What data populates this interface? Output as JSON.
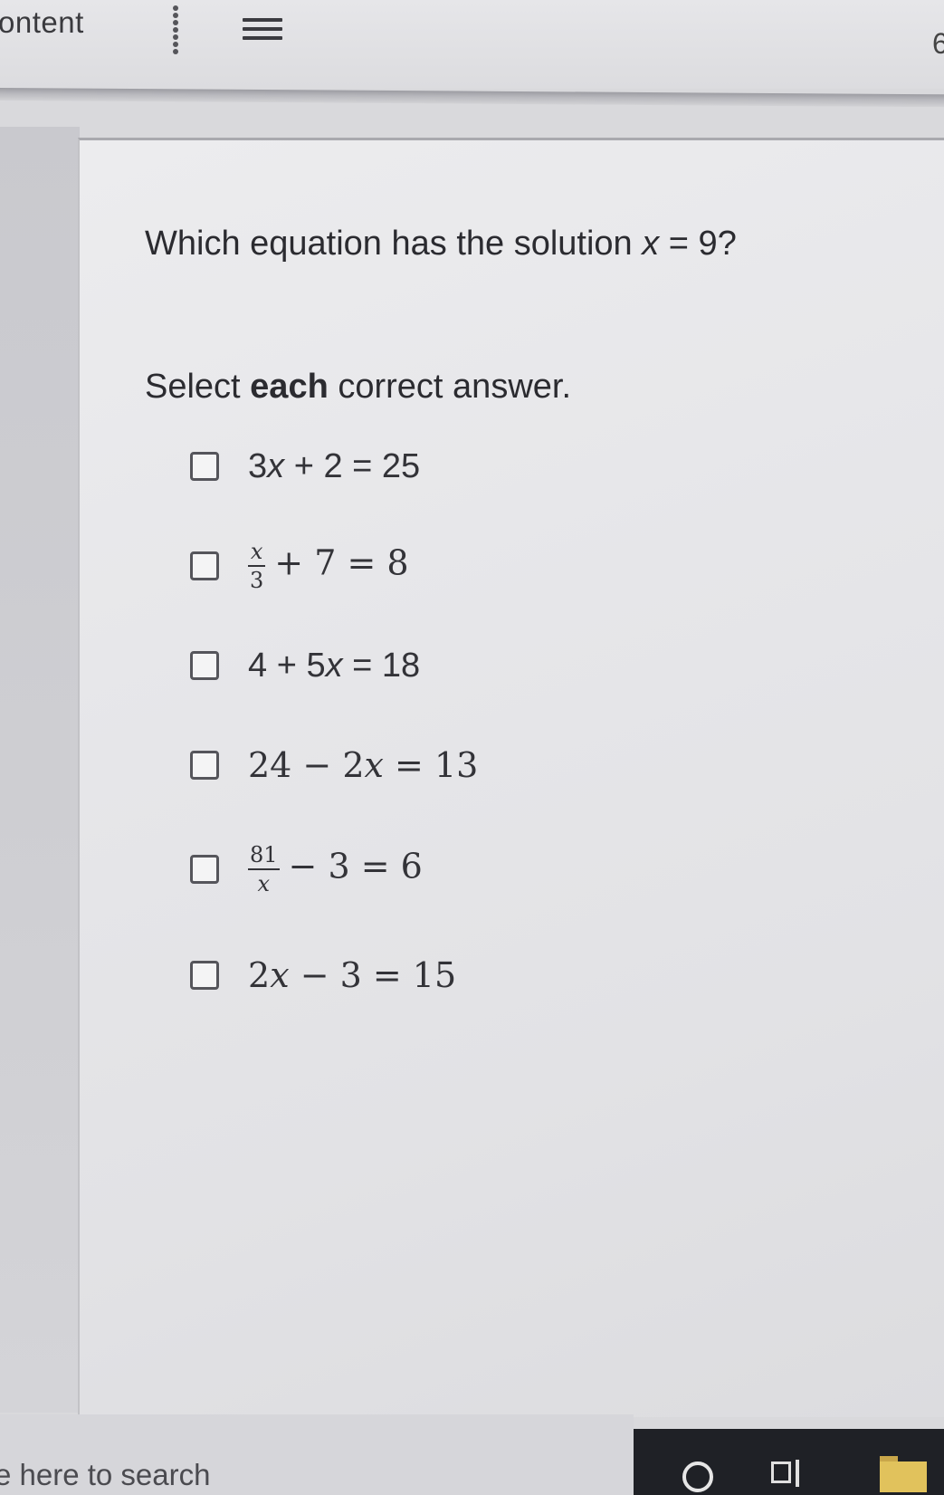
{
  "toolbar": {
    "label": "ontent",
    "right_edge_glyph": "6"
  },
  "question": {
    "prefix": "Which equation has the solution ",
    "variable": "x",
    "suffix": " = 9?"
  },
  "instructions": {
    "before": "Select ",
    "bold": "each",
    "after": " correct answer."
  },
  "options": [
    {
      "pre": "3",
      "var": "x",
      "post": " + 2 = 25",
      "checked": false
    },
    {
      "num": "x",
      "den": "3",
      "post": "+ 7 = 8",
      "checked": false
    },
    {
      "pre": "4 + 5",
      "var": "x",
      "post": " = 18",
      "checked": false
    },
    {
      "pre": "24 − 2",
      "var": "x",
      "post": " = 13",
      "checked": false
    },
    {
      "num": "81",
      "den": "x",
      "post": "− 3 = 6",
      "checked": false
    },
    {
      "pre": "2",
      "var": "x",
      "post": " − 3 = 15",
      "checked": false
    }
  ],
  "taskbar": {
    "search_placeholder": "e here to search",
    "icons": [
      "kebab-icon",
      "hamburger-menu-icon",
      "cortana-circle-icon",
      "task-view-icon",
      "file-explorer-folder-icon"
    ]
  }
}
